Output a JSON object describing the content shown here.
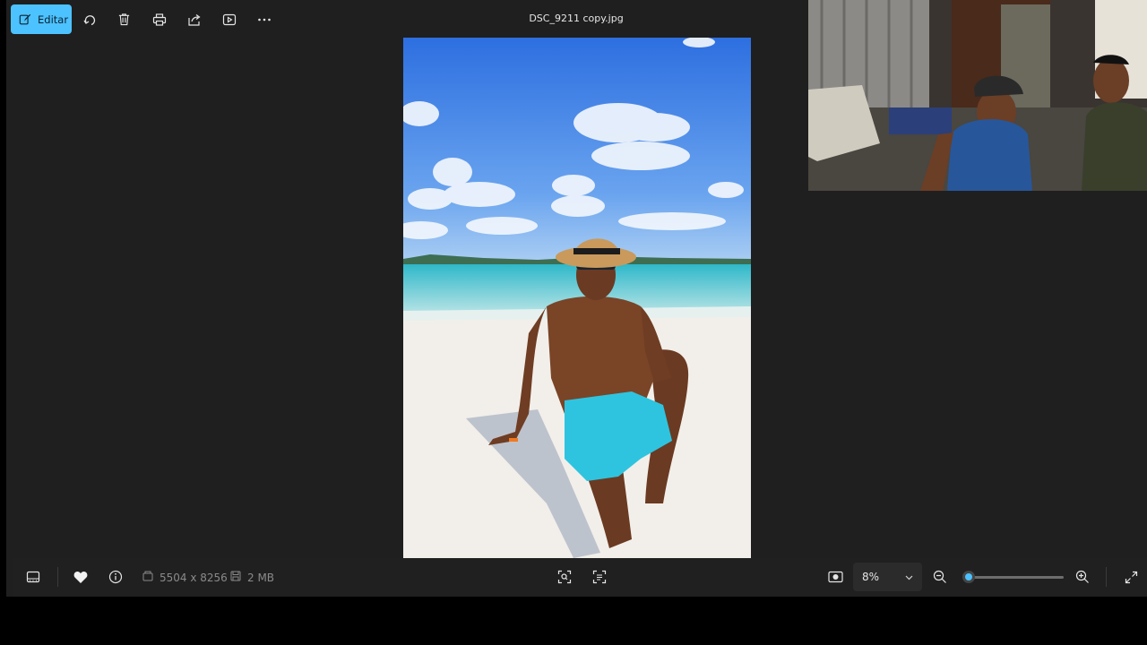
{
  "toolbar": {
    "edit_label": "Editar",
    "icons": [
      "edit-icon",
      "rotate-icon",
      "delete-icon",
      "print-icon",
      "share-icon",
      "slideshow-icon",
      "more-icon"
    ]
  },
  "file": {
    "title": "DSC_9211 copy.jpg",
    "dimensions": "5504 x 8256",
    "size": "2 MB"
  },
  "zoom": {
    "value": "8%",
    "level": 0.02
  },
  "colors": {
    "accent": "#4cc2ff",
    "background": "#1f1f1f",
    "bottombar": "#202020"
  }
}
